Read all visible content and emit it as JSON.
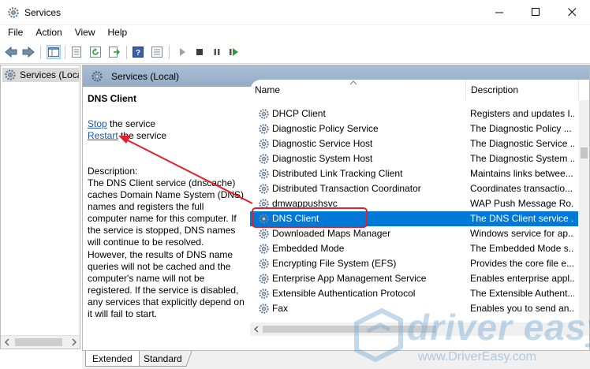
{
  "window": {
    "title": "Services",
    "controls": {
      "minimize": "minimize-icon",
      "maximize": "maximize-icon",
      "close": "close-icon"
    }
  },
  "menu": [
    "File",
    "Action",
    "View",
    "Help"
  ],
  "toolbar": {
    "icons": [
      "back-icon",
      "forward-icon",
      "show-tree-icon",
      "properties-icon",
      "refresh-icon",
      "export-icon",
      "help-icon",
      "view-icon",
      "start-icon",
      "stop-icon",
      "pause-icon",
      "restart-icon"
    ]
  },
  "tree": {
    "root_label": "Services (Loca"
  },
  "header": {
    "title": "Services (Local)"
  },
  "detail": {
    "service_name": "DNS Client",
    "stop_link": "Stop",
    "stop_suffix": " the service",
    "restart_link": "Restart",
    "restart_suffix": " the service",
    "description_label": "Description:",
    "description": "The DNS Client service (dnscache) caches Domain Name System (DNS) names and registers the full computer name for this computer. If the service is stopped, DNS names will continue to be resolved. However, the results of DNS name queries will not be cached and the computer's name will not be registered. If the service is disabled, any services that explicitly depend on it will fail to start."
  },
  "list": {
    "columns": {
      "name": "Name",
      "description": "Description"
    },
    "rows": [
      {
        "name": "DHCP Client",
        "description": "Registers and updates I..."
      },
      {
        "name": "Diagnostic Policy Service",
        "description": "The Diagnostic Policy ..."
      },
      {
        "name": "Diagnostic Service Host",
        "description": "The Diagnostic Service ..."
      },
      {
        "name": "Diagnostic System Host",
        "description": "The Diagnostic System ..."
      },
      {
        "name": "Distributed Link Tracking Client",
        "description": "Maintains links betwee..."
      },
      {
        "name": "Distributed Transaction Coordinator",
        "description": "Coordinates transactio..."
      },
      {
        "name": "dmwappushsvc",
        "description": "WAP Push Message Ro..."
      },
      {
        "name": "DNS Client",
        "description": "The DNS Client service ..."
      },
      {
        "name": "Downloaded Maps Manager",
        "description": "Windows service for ap..."
      },
      {
        "name": "Embedded Mode",
        "description": "The Embedded Mode s..."
      },
      {
        "name": "Encrypting File System (EFS)",
        "description": "Provides the core file e..."
      },
      {
        "name": "Enterprise App Management Service",
        "description": "Enables enterprise appl..."
      },
      {
        "name": "Extensible Authentication Protocol",
        "description": "The Extensible Authent..."
      },
      {
        "name": "Fax",
        "description": "Enables you to send an..."
      }
    ],
    "selected_row": "DNS Client"
  },
  "tabs": [
    "Extended",
    "Standard"
  ],
  "watermark": {
    "brand": "driver easy",
    "url": "www.DriverEasy.com"
  },
  "colors": {
    "selection": "#0078d7",
    "annotation": "#e0202a",
    "header_gradient": "#a9bfd6",
    "link": "#2255aa"
  }
}
